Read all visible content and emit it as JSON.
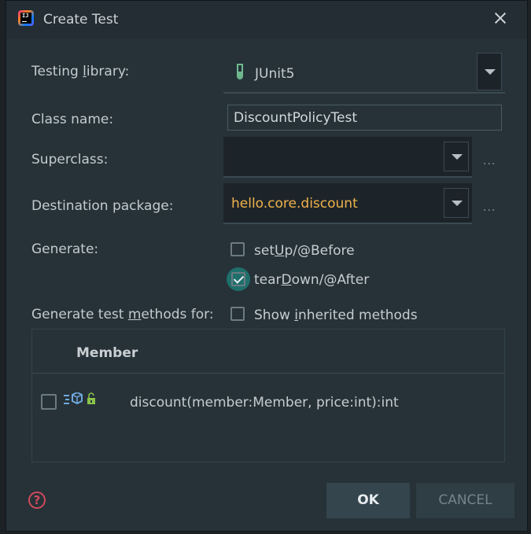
{
  "window": {
    "title": "Create Test",
    "app_icon_text": "IJ"
  },
  "form": {
    "testing_library": {
      "pre": "Testing ",
      "mnemonic": "l",
      "post": "ibrary:",
      "value": "JUnit5"
    },
    "class_name": {
      "label": "Class name:",
      "value": "DiscountPolicyTest"
    },
    "superclass": {
      "label": "Superclass:",
      "value": ""
    },
    "destination_package": {
      "label": "Destination package:",
      "value": "hello.core.discount"
    },
    "generate": {
      "label": "Generate:",
      "setup": {
        "pre": "set",
        "mnemonic": "U",
        "post": "p/@Before",
        "checked": false
      },
      "teardown": {
        "pre": "tear",
        "mnemonic": "D",
        "post": "own/@After",
        "checked": true
      }
    },
    "methods_for": {
      "pre": "Generate test ",
      "mnemonic": "m",
      "post": "ethods for:",
      "show_inherited": {
        "pre": "Show ",
        "mnemonic": "i",
        "post": "nherited methods",
        "checked": false
      }
    },
    "ellipsis": "..."
  },
  "table": {
    "header": "Member",
    "rows": [
      {
        "signature": "discount(member:Member, price:int):int",
        "checked": false
      }
    ]
  },
  "buttons": {
    "ok": "OK",
    "cancel": "CANCEL",
    "help": "?"
  },
  "colors": {
    "background": "#263238",
    "package_text": "#f0b24a",
    "accent_check": "#1f6f6b"
  }
}
